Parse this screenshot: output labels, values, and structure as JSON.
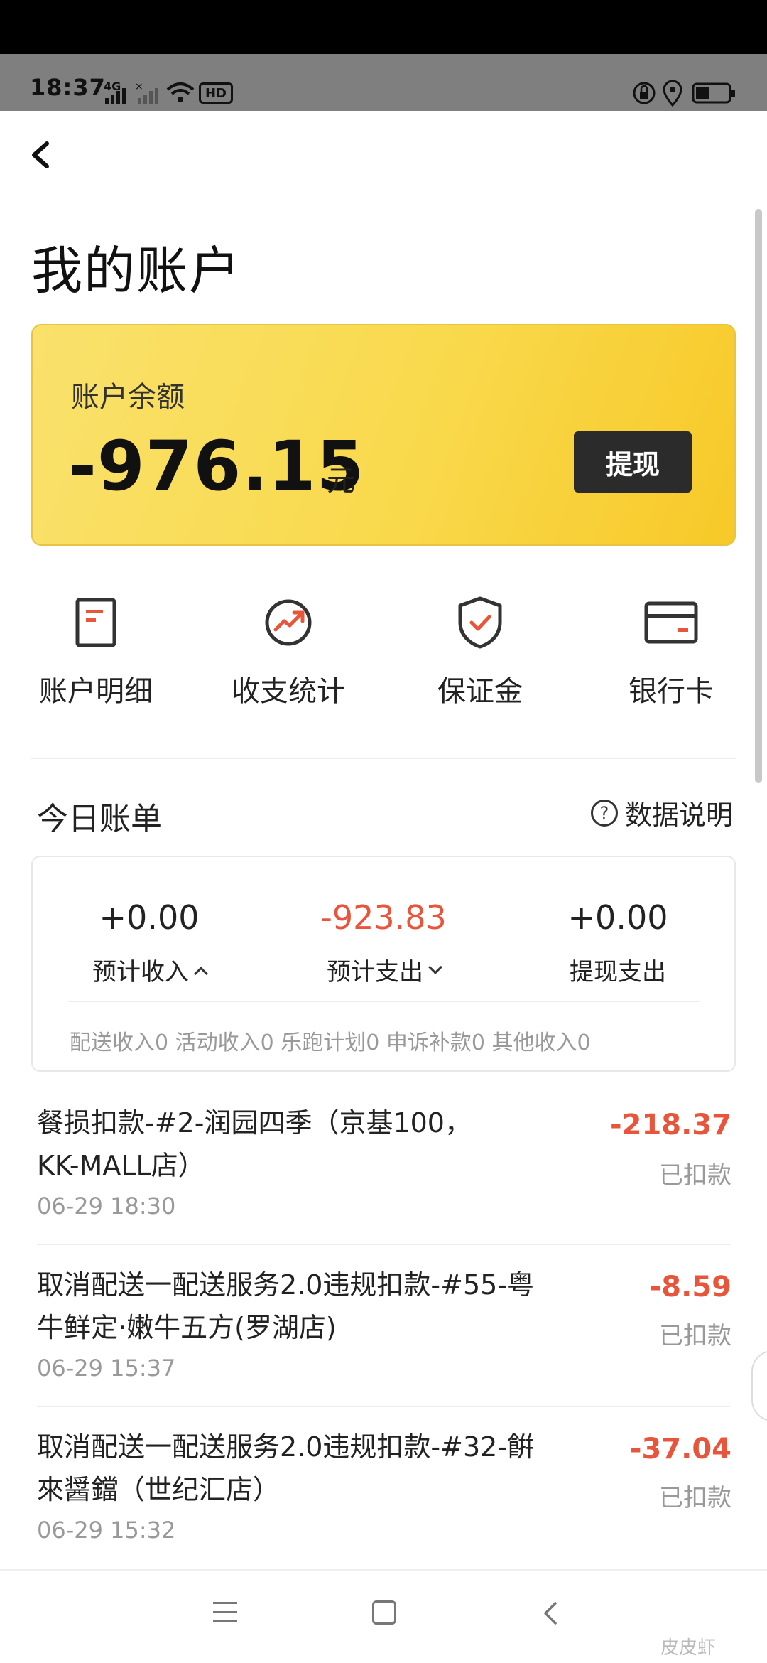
{
  "status_bar": {
    "time": "18:37",
    "network": "4G",
    "wifi_badge": "HD"
  },
  "header": {
    "title": "我的账户"
  },
  "balance": {
    "label": "账户余额",
    "amount": "-976.15",
    "unit": "元",
    "withdraw_label": "提现"
  },
  "quick_actions": [
    {
      "label": "账户明细",
      "icon": "document-icon"
    },
    {
      "label": "收支统计",
      "icon": "stats-icon"
    },
    {
      "label": "保证金",
      "icon": "shield-icon"
    },
    {
      "label": "银行卡",
      "icon": "card-icon"
    }
  ],
  "today_bill": {
    "title": "今日账单",
    "data_explain": "数据说明",
    "summary": [
      {
        "value": "+0.00",
        "label": "预计收入"
      },
      {
        "value": "-923.83",
        "label": "预计支出"
      },
      {
        "value": "+0.00",
        "label": "提现支出"
      }
    ],
    "breakdown": "配送收入0 活动收入0 乐跑计划0 申诉补款0 其他收入0"
  },
  "transactions": [
    {
      "title_line1": "餐损扣款-#2-润园四季（京基100，",
      "title_line2": "KK-MALL店）",
      "time": "06-29 18:30",
      "amount": "-218.37",
      "status": "已扣款"
    },
    {
      "title_line1": "取消配送一配送服务2.0违规扣款-#55-粤",
      "title_line2": "牛鲜定·嫩牛五方(罗湖店)",
      "time": "06-29 15:37",
      "amount": "-8.59",
      "status": "已扣款"
    },
    {
      "title_line1": "取消配送一配送服务2.0违规扣款-#32-餠",
      "title_line2": "來醤鐺（世纪汇店）",
      "time": "06-29 15:32",
      "amount": "-37.04",
      "status": "已扣款"
    }
  ],
  "watermark": "皮皮虾",
  "colors": {
    "accent_yellow": "#f9d94c",
    "negative_red": "#e8553b",
    "dark_button": "#2b2b2b"
  }
}
